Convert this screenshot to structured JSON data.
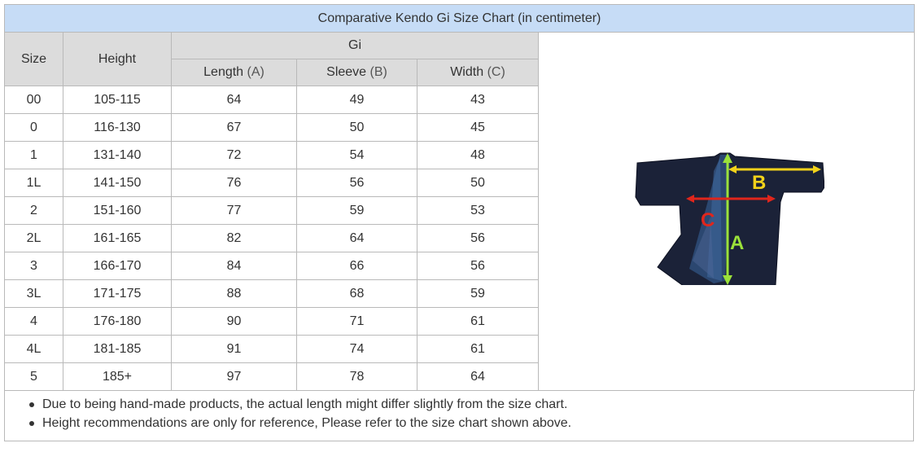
{
  "title": "Comparative Kendo Gi Size Chart (in centimeter)",
  "headers": {
    "size": "Size",
    "height": "Height",
    "gi": "Gi",
    "length": "Length",
    "length_dim": "(A)",
    "sleeve": "Sleeve",
    "sleeve_dim": "(B)",
    "width": "Width",
    "width_dim": "(C)"
  },
  "rows": [
    {
      "size": "00",
      "height": "105-115",
      "length": "64",
      "sleeve": "49",
      "width": "43"
    },
    {
      "size": "0",
      "height": "116-130",
      "length": "67",
      "sleeve": "50",
      "width": "45"
    },
    {
      "size": "1",
      "height": "131-140",
      "length": "72",
      "sleeve": "54",
      "width": "48"
    },
    {
      "size": "1L",
      "height": "141-150",
      "length": "76",
      "sleeve": "56",
      "width": "50"
    },
    {
      "size": "2",
      "height": "151-160",
      "length": "77",
      "sleeve": "59",
      "width": "53"
    },
    {
      "size": "2L",
      "height": "161-165",
      "length": "82",
      "sleeve": "64",
      "width": "56"
    },
    {
      "size": "3",
      "height": "166-170",
      "length": "84",
      "sleeve": "66",
      "width": "56"
    },
    {
      "size": "3L",
      "height": "171-175",
      "length": "88",
      "sleeve": "68",
      "width": "59"
    },
    {
      "size": "4",
      "height": "176-180",
      "length": "90",
      "sleeve": "71",
      "width": "61"
    },
    {
      "size": "4L",
      "height": "181-185",
      "length": "91",
      "sleeve": "74",
      "width": "61"
    },
    {
      "size": "5",
      "height": "185+",
      "length": "97",
      "sleeve": "78",
      "width": "64"
    }
  ],
  "image": {
    "label_a": "A",
    "label_b": "B",
    "label_c": "C",
    "color_a": "#9be13a",
    "color_b": "#f2d21a",
    "color_c": "#e0261c"
  },
  "notes": [
    "Due to being hand-made products, the actual length might differ slightly from the size chart.",
    "Height recommendations are only for reference, Please refer to the size chart shown above."
  ]
}
